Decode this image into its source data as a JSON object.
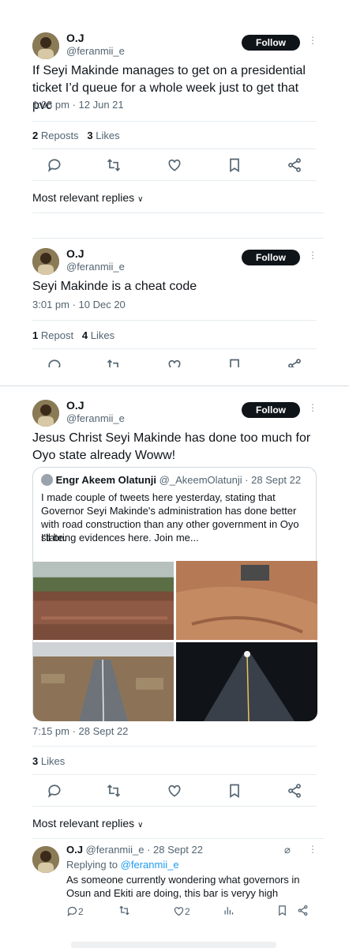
{
  "colors": {
    "accent": "#1d9bf0",
    "text": "#0f1419",
    "muted": "#536471",
    "follow_bg": "#0f1419"
  },
  "tweets": [
    {
      "name": "O.J",
      "handle": "@feranmii_e",
      "follow_label": "Follow",
      "text": "If Seyi Makinde manages to get on a presidential ticket I’d queue for a whole week just to get that pvc",
      "time": "1:08 pm · 12 Jun 21",
      "reposts_count": "2",
      "reposts_label": "Reposts",
      "likes_count": "3",
      "likes_label": "Likes",
      "replies_sort": "Most relevant replies"
    },
    {
      "name": "O.J",
      "handle": "@feranmii_e",
      "follow_label": "Follow",
      "text": "Seyi Makinde is a cheat code",
      "time": "3:01 pm · 10 Dec 20",
      "reposts_count": "1",
      "reposts_label": "Repost",
      "likes_count": "4",
      "likes_label": "Likes"
    },
    {
      "name": "O.J",
      "handle": "@feranmii_e",
      "follow_label": "Follow",
      "text": "Jesus Christ Seyi Makinde has done too much for Oyo state already Woww!",
      "quote": {
        "name": "Engr Akeem Olatunji",
        "handle_date": "@_AkeemOlatunji · 28 Sept 22",
        "text": "I made couple of tweets here yesterday, stating that Governor Seyi Makinde's administration has done better with road construction than any other government in Oyo state.",
        "text2": "I'll bring evidences here. Join me..."
      },
      "time": "7:15 pm · 28 Sept 22",
      "likes_count": "3",
      "likes_label": "Likes",
      "replies_sort": "Most relevant replies"
    }
  ],
  "reply": {
    "name": "O.J",
    "handle_date": "@feranmii_e · 28 Sept 22",
    "replying_prefix": "Replying to",
    "replying_handle": "@feranmii_e",
    "text": "As someone currently wondering what governors in Osun and Ekiti are doing, this bar is veryy high",
    "reply_count": "2",
    "like_count": "2"
  },
  "icons": {
    "reply": "speech-bubble-icon",
    "repost": "repost-arrows-icon",
    "like": "heart-icon",
    "bookmark": "bookmark-icon",
    "share": "share-icon",
    "views": "bar-chart-icon",
    "grok": "grok-icon",
    "more": "more-dots-icon"
  }
}
